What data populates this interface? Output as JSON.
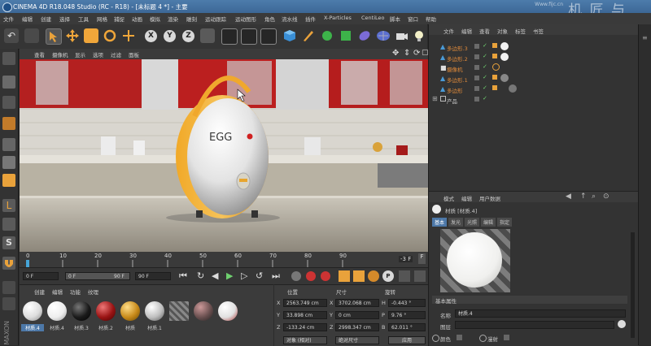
{
  "titlebar": {
    "title": "CINEMA 4D R18.048 Studio (RC - R18) - [未标题 4 *] - 主要",
    "watermark": "机 匠 与",
    "watermark_sub": "Www.fijc.cn"
  },
  "menu": [
    "文件",
    "编辑",
    "创建",
    "选择",
    "工具",
    "网格",
    "捕捉",
    "动画",
    "模拟",
    "渲染",
    "雕刻",
    "运动跟踪",
    "运动图形",
    "角色",
    "流水线",
    "插件",
    "X-Particles",
    "CentiLeo",
    "脚本",
    "窗口",
    "帮助"
  ],
  "viewport_menu": [
    "查看",
    "摄像机",
    "显示",
    "选项",
    "过滤",
    "面板"
  ],
  "product_label": "EGG",
  "timeline": {
    "ticks": [
      "0",
      "10",
      "20",
      "30",
      "40",
      "50",
      "60",
      "70",
      "80",
      "90"
    ],
    "end_frame": "-3 F"
  },
  "playbar": {
    "start": "0 F",
    "current": "0 F",
    "range_end": "90 F",
    "end": "90 F"
  },
  "material_manager": {
    "menu": [
      "创建",
      "编辑",
      "功能",
      "纹理"
    ],
    "materials": [
      {
        "label": "材质.4",
        "color": "#e8e8e8",
        "selected": true
      },
      {
        "label": "材质.4",
        "color": "#f0f0f0"
      },
      {
        "label": "材质.3",
        "color": "#1a1a1a"
      },
      {
        "label": "材质.2",
        "color": "#9a1414"
      },
      {
        "label": "材质",
        "color": "#c88a1a"
      },
      {
        "label": "材质.1",
        "color": "#bfbfbf"
      },
      {
        "label": "",
        "color": "striped"
      },
      {
        "label": "",
        "color": "#6a5050"
      },
      {
        "label": "",
        "color": "#e0e0e0"
      }
    ]
  },
  "coordinates": {
    "headers": [
      "位置",
      "尺寸",
      "旋转"
    ],
    "rows": [
      {
        "axis": "X",
        "pos": "2563.749 cm",
        "size_axis": "X",
        "size": "3702.068 cm",
        "rot_axis": "H",
        "rot": "-0.443 °"
      },
      {
        "axis": "Y",
        "pos": "33.898 cm",
        "size_axis": "Y",
        "size": "0 cm",
        "rot_axis": "P",
        "rot": "9.76 °"
      },
      {
        "axis": "Z",
        "pos": "-133.24 cm",
        "size_axis": "Z",
        "size": "2998.347 cm",
        "rot_axis": "B",
        "rot": "62.011 °"
      }
    ],
    "mode": "对象 (相对)",
    "size_mode": "绝对尺寸",
    "apply": "应用"
  },
  "object_manager": {
    "menu": [
      "文件",
      "编辑",
      "查看",
      "对象",
      "标签",
      "书签"
    ],
    "objects": [
      {
        "name": "多边形.3"
      },
      {
        "name": "多边形.2"
      },
      {
        "name": "摄像机"
      },
      {
        "name": "多边形.1"
      },
      {
        "name": "多边形"
      },
      {
        "name": "产品"
      }
    ]
  },
  "attributes": {
    "menu": [
      "模式",
      "编辑",
      "用户数据"
    ],
    "object_label": "材质 [材质.4]",
    "tabs": [
      "基本",
      "发光",
      "光照",
      "编辑",
      "指定"
    ],
    "section": "基本属性",
    "name_label": "名称",
    "name_value": "材质.4",
    "layer_label": "图层",
    "color_label": "颜色",
    "diffuse_label": "漫射"
  },
  "colors": {
    "accent": "#e8a53a",
    "selection": "#4d78a8",
    "title": "#3c6796"
  }
}
